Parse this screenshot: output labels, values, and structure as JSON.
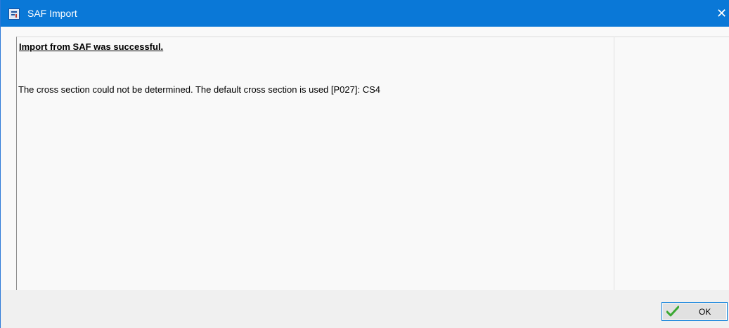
{
  "window": {
    "title": "SAF Import",
    "close_glyph": "✕",
    "title_icon": "app-icon"
  },
  "message": {
    "heading": "Import from SAF was successful.",
    "lines": [
      "The cross section could not be determined. The default cross section is used [P027]: CS4"
    ]
  },
  "footer": {
    "ok_label": "OK",
    "ok_icon": "checkmark-icon"
  },
  "colors": {
    "titlebar": "#0a78d7",
    "checkmark": "#3aa832",
    "button_border": "#0078d7"
  }
}
